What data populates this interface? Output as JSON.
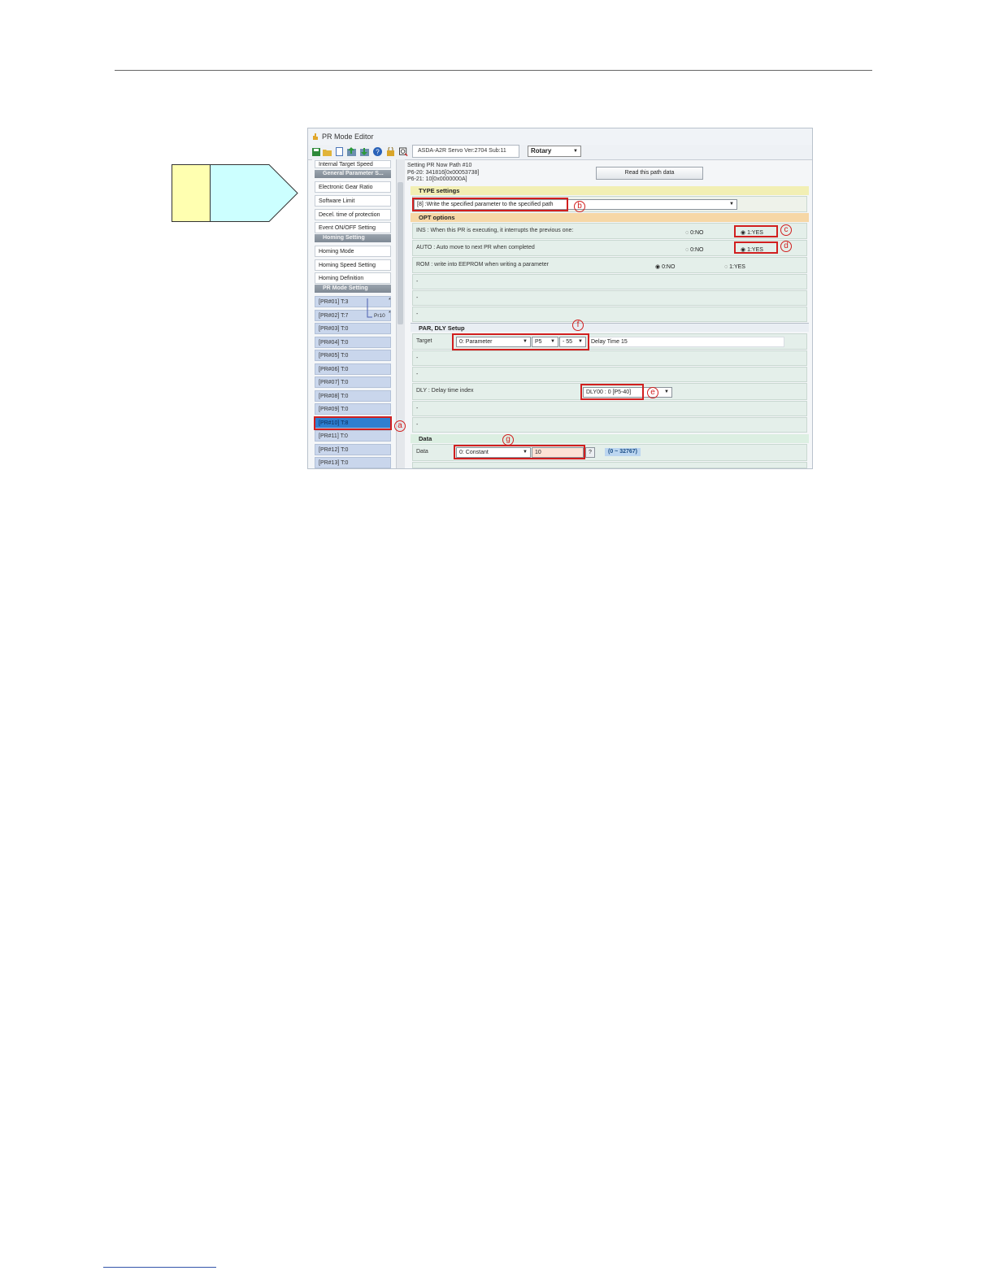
{
  "window": {
    "title": "PR Mode Editor"
  },
  "toolbar": {
    "device_tab": "ASDA-A2R Servo Ver:2704 Sub:11",
    "mode_select": "Rotary"
  },
  "left_panel": {
    "items": [
      "Internal Target Speed",
      "Electronic Gear Ratio",
      "Software Limit",
      "Decel. time of protection",
      "Event ON/OFF Setting",
      "Homing Mode",
      "Homing Speed Setting",
      "Homing Definition"
    ],
    "headers": [
      "General Parameter S...",
      "Homing Setting",
      "PR Mode Setting"
    ],
    "pr_rows": [
      {
        "label": "[PR#01]    T:3"
      },
      {
        "label": "[PR#02]    T:7"
      },
      {
        "label": "[PR#03]    T:0"
      },
      {
        "label": "[PR#04]    T:0"
      },
      {
        "label": "[PR#05]    T:0"
      },
      {
        "label": "[PR#06]    T:0"
      },
      {
        "label": "[PR#07]    T:0"
      },
      {
        "label": "[PR#08]    T:0"
      },
      {
        "label": "[PR#09]    T:0"
      },
      {
        "label": "[PR#10]    T:8"
      },
      {
        "label": "[PR#11]    T:0"
      },
      {
        "label": "[PR#12]    T:0"
      },
      {
        "label": "[PR#13]    T:0"
      }
    ],
    "pr_link_label": "Pr10"
  },
  "header": {
    "line1": "Setting PR Now Path #10",
    "line2": "P6-20: 341816[0x00053738]",
    "line3": "P6-21: 10[0x0000000A]",
    "read_button": "Read this path data"
  },
  "type_settings": {
    "title": "TYPE settings",
    "value": "[8] :Write the specified parameter to the specified path"
  },
  "opt_options": {
    "title": "OPT options",
    "ins_label": "INS : When this PR is executing, it interrupts the previous one:",
    "auto_label": "AUTO : Auto move to next PR when completed",
    "rom_label": "ROM : write into EEPROM when writing a parameter",
    "no_option": "0:NO",
    "yes_option": "1:YES"
  },
  "par_dly": {
    "title": "PAR, DLY Setup",
    "target_label": "Target",
    "target_type": "0: Parameter",
    "param_group": "P5",
    "param_num": "- 55",
    "delay_text": "Delay Time 15",
    "dly_label": "DLY : Delay time index",
    "dly_value": "DLY00 : 0 [P5-40]",
    "dash": "-"
  },
  "data_section": {
    "title": "Data",
    "label": "Data",
    "type": "0: Constant",
    "value": "10",
    "help": "?",
    "range": "(0 ~ 32767)"
  },
  "callouts": [
    "a",
    "b",
    "c",
    "d",
    "e",
    "f",
    "g"
  ]
}
